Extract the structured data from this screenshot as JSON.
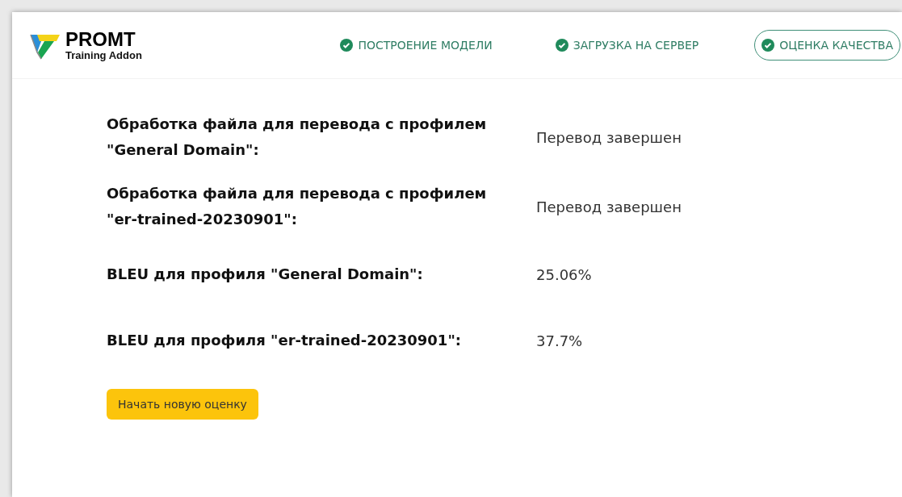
{
  "logo": {
    "title": "PROMT",
    "subtitle": "Training Addon"
  },
  "steps": [
    {
      "label": "ПОСТРОЕНИЕ МОДЕЛИ",
      "done": true,
      "selected": false
    },
    {
      "label": "ЗАГРУЗКА НА СЕРВЕР",
      "done": true,
      "selected": false
    },
    {
      "label": "ОЦЕНКА КАЧЕСТВА",
      "done": true,
      "selected": true
    }
  ],
  "results": [
    {
      "label": "Обработка файла для перевода с профилем \"General Domain\":",
      "value": "Перевод завершен"
    },
    {
      "label": "Обработка файла для перевода с профилем \"er-trained-20230901\":",
      "value": "Перевод завершен"
    },
    {
      "label": "BLEU для профиля \"General Domain\":",
      "value": "25.06%"
    },
    {
      "label": "BLEU для профиля \"er-trained-20230901\":",
      "value": "37.7%"
    }
  ],
  "button": "Начать новую оценку"
}
